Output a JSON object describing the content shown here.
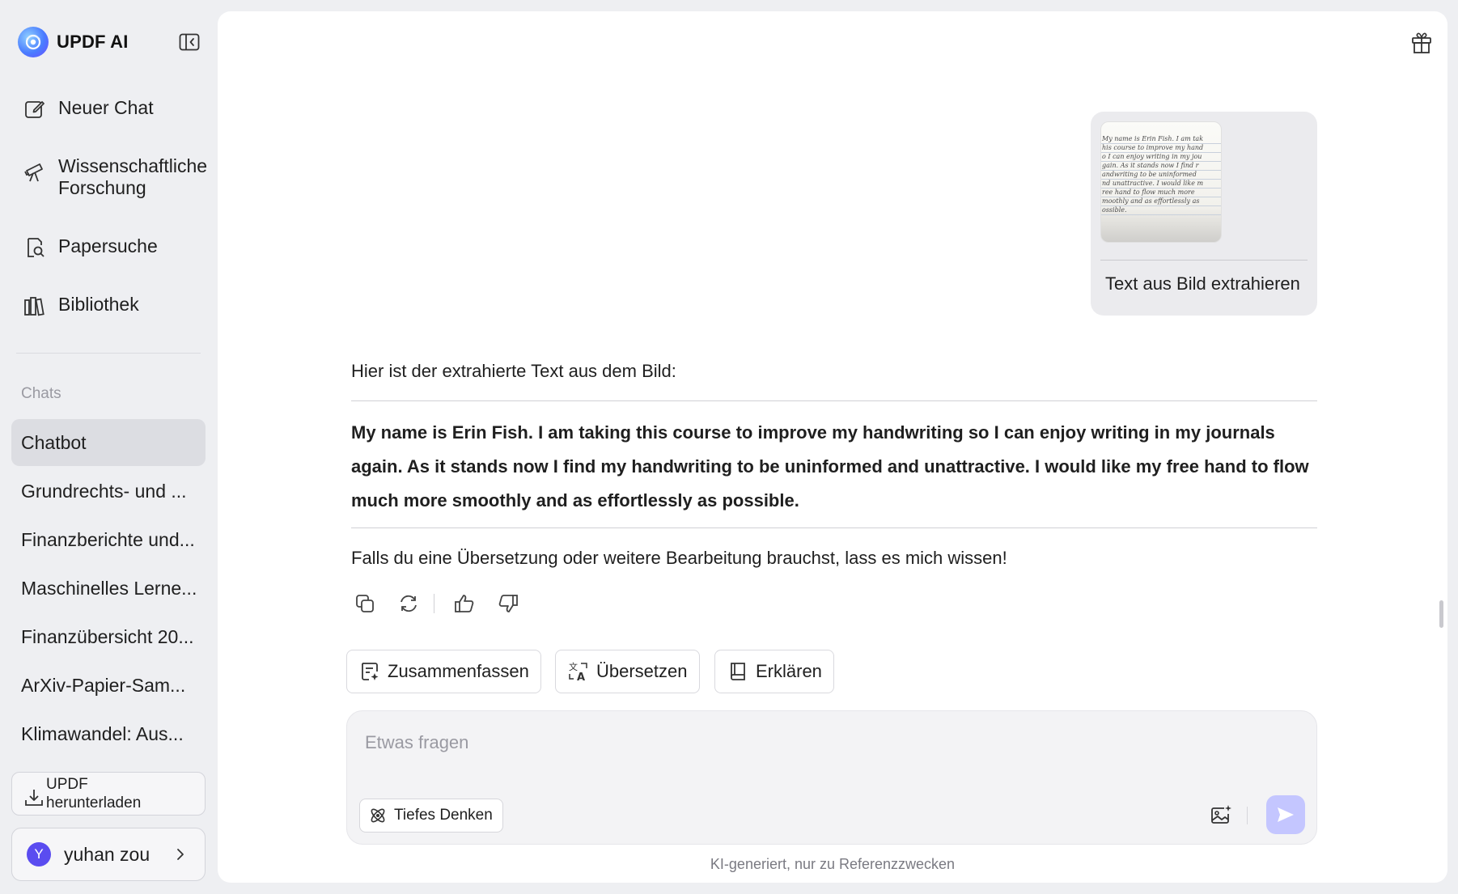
{
  "app": {
    "name": "UPDF AI"
  },
  "sidebar": {
    "nav": [
      {
        "label": "Neuer Chat",
        "icon": "edit-icon"
      },
      {
        "label": "Wissenschaftliche Forschung",
        "icon": "telescope-icon"
      },
      {
        "label": "Papersuche",
        "icon": "document-search-icon"
      },
      {
        "label": "Bibliothek",
        "icon": "library-icon"
      }
    ],
    "chats_header": "Chats",
    "chats": [
      "Chatbot",
      "Grundrechts- und ...",
      "Finanzberichte und...",
      "Maschinelles Lerne...",
      "Finanzübersicht 20...",
      "ArXiv-Papier-Sam...",
      "Klimawandel: Aus..."
    ],
    "download_label": "UPDF herunterladen",
    "user": {
      "initial": "Y",
      "name": "yuhan zou"
    }
  },
  "conversation": {
    "user_message": {
      "text": "Text aus Bild extrahieren",
      "image_text_lines": [
        "My name is Erin Fish. I am tak",
        "his course to improve my hand",
        "o I can enjoy writing in my jou",
        "gain. As it stands now I find r",
        "andwriting to be uninformed",
        "nd unattractive. I would like m",
        "ree hand to flow much more",
        "moothly and as effortlessly as",
        "ossible."
      ]
    },
    "ai_message": {
      "intro": "Hier ist der extrahierte Text aus dem Bild:",
      "extracted": "My name is Erin Fish. I am taking this course to improve my handwriting so I can enjoy writing in my journals again. As it stands now I find my handwriting to be uninformed and unattractive. I would like my free hand to flow much more smoothly and as effortlessly as possible.",
      "outro": "Falls du eine Übersetzung oder weitere Bearbeitung brauchst, lass es mich wissen!"
    }
  },
  "quick_actions": [
    {
      "label": "Zusammenfassen",
      "icon": "summarize-icon"
    },
    {
      "label": "Übersetzen",
      "icon": "translate-icon"
    },
    {
      "label": "Erklären",
      "icon": "book-icon"
    }
  ],
  "composer": {
    "placeholder": "Etwas fragen",
    "deep_think_label": "Tiefes Denken"
  },
  "disclaimer": "KI-generiert, nur zu Referenzzwecken",
  "colors": {
    "accent": "#5a4cf0",
    "send_disabled": "#c4c6ff",
    "active_chat": "#dcdde2"
  }
}
